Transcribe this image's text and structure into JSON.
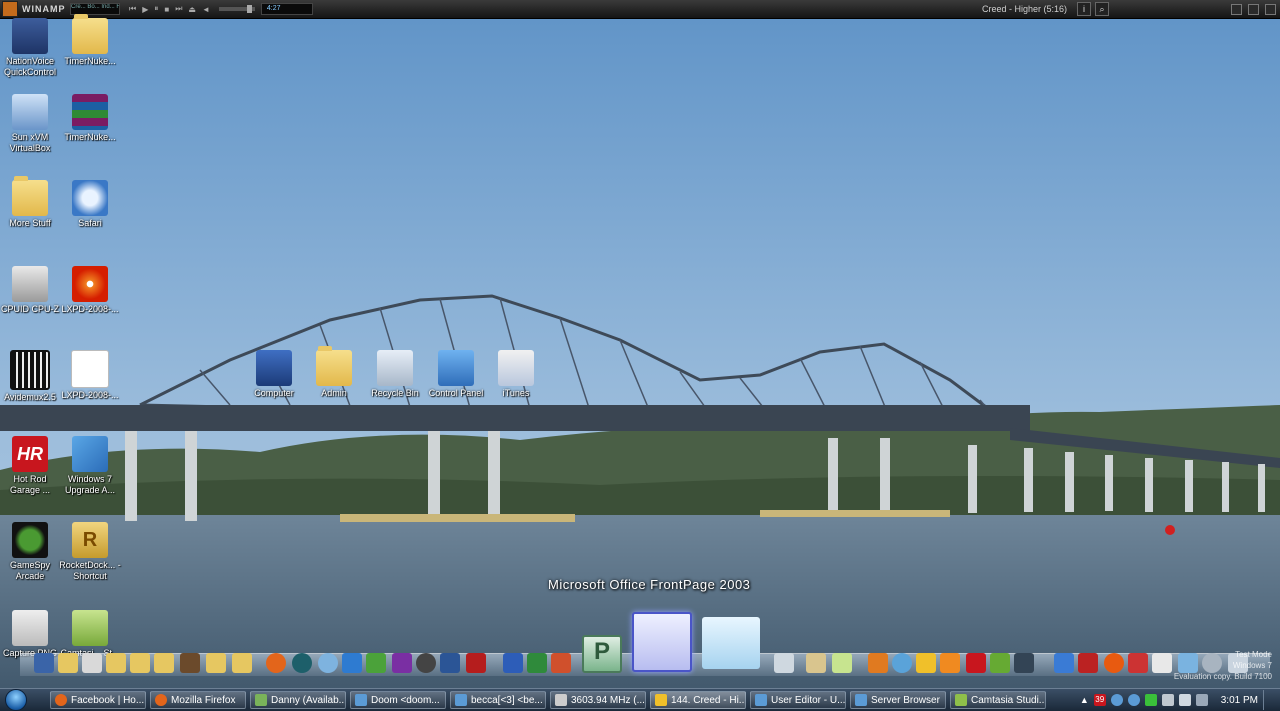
{
  "winamp": {
    "title": "WINAMP",
    "viz_text": "Cre... Bo... Ind... Higher...",
    "time": "4:27",
    "track": "Creed - Higher (5:16)",
    "btn_info": "i",
    "btn_search": "⌕"
  },
  "desktop_icons": {
    "nationvoice": "NationVoice QuickControl",
    "timernuke1": "TimerNuke...",
    "virtualbox": "Sun xVM VirtualBox",
    "timernuke2": "TimerNuke...",
    "morestuff": "More Stuff",
    "safari": "Safari",
    "cpuz": "CPUID CPU-Z",
    "lxpd1": "LXPD-2008-...",
    "avidemux": "Avidemux2.5",
    "lxpd2": "LXPD-2008-...",
    "hotrod": "Hot Rod Garage ...",
    "win7": "Windows 7 Upgrade A...",
    "gamespy": "GameSpy Arcade",
    "rocketdock": "RocketDock... - Shortcut",
    "capture": "Capture.PNG",
    "camtasia": "Camtasi... St...",
    "computer": "Computer",
    "admin": "Admin",
    "recyclebin": "Recycle Bin",
    "controlpanel": "Control Panel",
    "itunes": "iTunes"
  },
  "dock": {
    "tooltip": "Microsoft Office FrontPage 2003",
    "publisher_letter": "P"
  },
  "taskbar": {
    "tasks": [
      "Facebook | Ho...",
      "Mozilla Firefox",
      "Danny (Availab...",
      "Doom <doom...",
      "becca[<3] <be...",
      "3603.94 MHz (...",
      "144. Creed - Hi...",
      "User Editor - U...",
      "Server Browser",
      "Camtasia Studi..."
    ],
    "tray_badge": "39",
    "clock": "3:01 PM"
  },
  "watermark": {
    "line1": "Test Mode",
    "line2": "Windows 7",
    "line3": "Evaluation copy. Build 7100"
  }
}
